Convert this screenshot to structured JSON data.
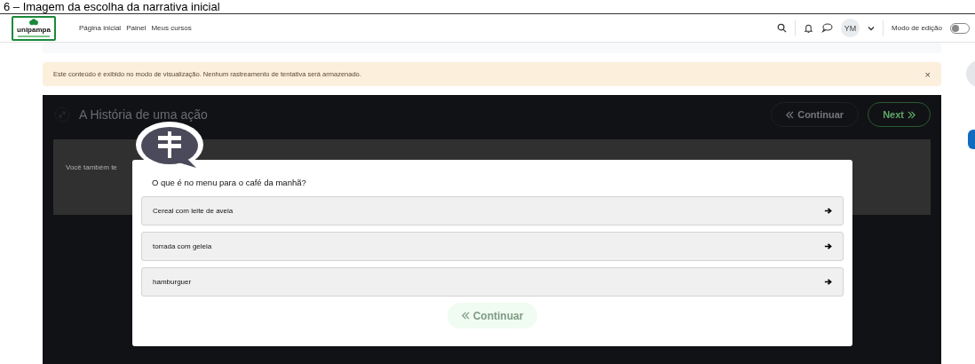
{
  "caption": "6 – Imagem da escolha da narrativa inicial",
  "navbar": {
    "logo": "unipampa",
    "links": [
      {
        "label": "Página inicial"
      },
      {
        "label": "Painel"
      },
      {
        "label": "Meus cursos"
      }
    ],
    "avatar": "YM",
    "edit_mode": {
      "label": "Modo de edição",
      "on": false
    }
  },
  "alert": {
    "text": "Este conteúdo é exibido no modo de visualização. Nenhum rastreamento de tentativa será armazenado.",
    "close": "×"
  },
  "activity": {
    "title": "A História de uma ação",
    "buttons": [
      {
        "label": "Continuar",
        "kind": "prev",
        "disabled": true
      },
      {
        "label": "Next",
        "kind": "next",
        "disabled": false
      }
    ],
    "body_text": "Você também te"
  },
  "dialog": {
    "question": "O que é no menu para o café da manhã?",
    "choices": [
      {
        "label": "Cereal com leite de aveia"
      },
      {
        "label": "torrada com geleia"
      },
      {
        "label": "hamburguer"
      }
    ],
    "continue": {
      "label": "Continuar",
      "disabled": true
    }
  }
}
